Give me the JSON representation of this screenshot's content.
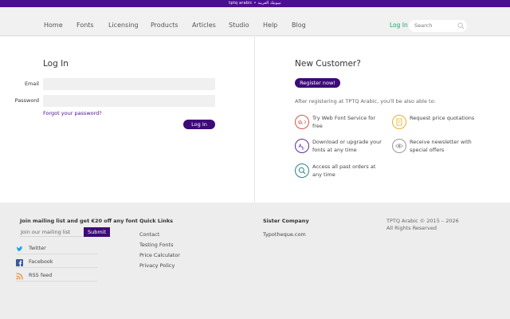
{
  "topbar": {
    "text": "tptq arabic • تيبوتيك العربية"
  },
  "nav": {
    "items": [
      "Home",
      "Fonts",
      "Licensing",
      "Products",
      "Articles",
      "Studio",
      "Help",
      "Blog"
    ],
    "login": "Log In",
    "search_placeholder": "Search"
  },
  "login": {
    "title": "Log In",
    "email_label": "Email",
    "password_label": "Password",
    "forgot": "Forgot your password?",
    "button": "Log In"
  },
  "new_customer": {
    "title": "New Customer?",
    "register_button": "Register now!",
    "after_text": "After registering at TPTQ Arabic, you'll be also able to:",
    "benefits": [
      {
        "icon": "web-font-icon",
        "text": "Try Web Font Service for free"
      },
      {
        "icon": "quotation-icon",
        "text": "Request price quotations"
      },
      {
        "icon": "download-icon",
        "text": "Download or upgrade your fonts at any time"
      },
      {
        "icon": "eye-icon",
        "text": "Receive newsletter with special offers"
      },
      {
        "icon": "search-orders-icon",
        "text": "Access all past orders at any time"
      }
    ]
  },
  "colors": {
    "brand_purple": "#4b0f91",
    "button_purple": "#3d0a78",
    "login_green": "#1ea36a",
    "benefit_red": "#d9534f",
    "benefit_yellow": "#e3b32a",
    "benefit_purple": "#5a2a9c",
    "benefit_grey": "#9a9a9a",
    "benefit_teal": "#2f7f86"
  },
  "footer": {
    "mailing": {
      "heading": "Join mailing list and get €20 off any font",
      "placeholder": "Join our mailing list",
      "submit": "Submit"
    },
    "social": [
      "Twitter",
      "Facebook",
      "RSS feed"
    ],
    "quick_links": {
      "heading": "Quick Links",
      "items": [
        "Contact",
        "Testing Fonts",
        "Price Calculator",
        "Privacy Policy"
      ]
    },
    "sister": {
      "heading": "Sister Company",
      "link": "Typotheque.com"
    },
    "copyright": {
      "line1": "TPTQ Arabic © 2015 – 2026",
      "line2": "All Rights Reserved"
    }
  }
}
